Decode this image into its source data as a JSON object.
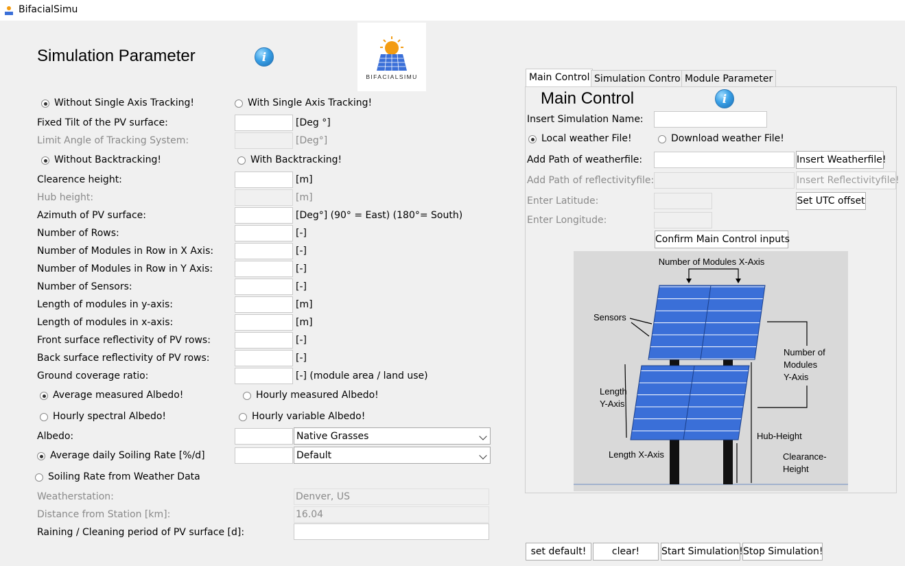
{
  "window": {
    "title": "BifacialSimu"
  },
  "logo": {
    "text": "BIFACIALSIMU"
  },
  "left": {
    "title": "Simulation Parameter",
    "tracking": {
      "without": "Without Single Axis Tracking!",
      "with": "With Single Axis Tracking!",
      "selected": "without"
    },
    "fixed_tilt": {
      "label": "Fixed Tilt of the PV surface:",
      "unit": "[Deg °]"
    },
    "limit_angle": {
      "label": "Limit Angle of Tracking System:",
      "unit": "[Deg°]"
    },
    "backtracking": {
      "without": "Without Backtracking!",
      "with": "With Backtracking!",
      "selected": "without"
    },
    "clearance": {
      "label": "Clearence height:",
      "unit": "[m]"
    },
    "hub": {
      "label": "Hub height:",
      "unit": "[m]"
    },
    "azimuth": {
      "label": "Azimuth of PV surface:",
      "unit": "[Deg°] (90° = East) (180°= South)"
    },
    "rows": {
      "label": "Number of Rows:",
      "unit": "[-]"
    },
    "mod_x": {
      "label": "Number of Modules in Row in X Axis:",
      "unit": "[-]"
    },
    "mod_y": {
      "label": "Number of Modules in Row in Y Axis:",
      "unit": "[-]"
    },
    "sensors": {
      "label": "Number of Sensors:",
      "unit": "[-]"
    },
    "len_y": {
      "label": "Length of modules in y-axis:",
      "unit": "[m]"
    },
    "len_x": {
      "label": "Length of modules in x-axis:",
      "unit": "[m]"
    },
    "front_ref": {
      "label": "Front surface reflectivity of PV rows:",
      "unit": "[-]"
    },
    "back_ref": {
      "label": "Back surface reflectivity of PV rows:",
      "unit": "[-]"
    },
    "gcr": {
      "label": "Ground coverage ratio:",
      "unit": "[-] (module area / land use)"
    },
    "albedo_opts": {
      "avg": "Average measured Albedo!",
      "hourly": "Hourly measured Albedo!",
      "spectral": "Hourly spectral Albedo!",
      "variable": "Hourly variable Albedo!",
      "selected": "avg"
    },
    "albedo": {
      "label": "Albedo:",
      "selected": "Native Grasses"
    },
    "soiling": {
      "avg": "Average daily Soiling Rate [%/d]",
      "weather": "Soiling Rate from Weather Data",
      "selected": "Default"
    },
    "weatherstation": {
      "label": "Weatherstation:",
      "value": "Denver, US"
    },
    "distance": {
      "label": "Distance from Station [km]:",
      "value": "16.04"
    },
    "raining": {
      "label": "Raining / Cleaning period of PV surface [d]:"
    }
  },
  "tabs": [
    "Main Control",
    "Simulation Control",
    "Module Parameter"
  ],
  "main": {
    "title": "Main Control",
    "sim_name": "Insert Simulation Name:",
    "weather": {
      "local": "Local weather File!",
      "download": "Download weather File!"
    },
    "path_weather": "Add Path of weatherfile:",
    "insert_weather": "Insert Weatherfile!",
    "path_refl": "Add Path of reflectivityfile:",
    "insert_refl": "Insert Reflectivityfile!",
    "latitude": "Enter Latitude:",
    "utc": "Set UTC offset",
    "longitude": "Enter Longitude:",
    "confirm": "Confirm Main Control inputs"
  },
  "diagram": {
    "mod_x": "Number of Modules X-Axis",
    "sensors": "Sensors",
    "mod_y_1": "Number of",
    "mod_y_2": "Modules",
    "mod_y_3": "Y-Axis",
    "len_y_1": "Length",
    "len_y_2": "Y-Axis",
    "hub": "Hub-Height",
    "len_x": "Length X-Axis",
    "clear_1": "Clearance-",
    "clear_2": "Height"
  },
  "buttons": {
    "default": "set default!",
    "clear": "clear!",
    "start": "Start Simulation!",
    "stop": "Stop Simulation!"
  }
}
